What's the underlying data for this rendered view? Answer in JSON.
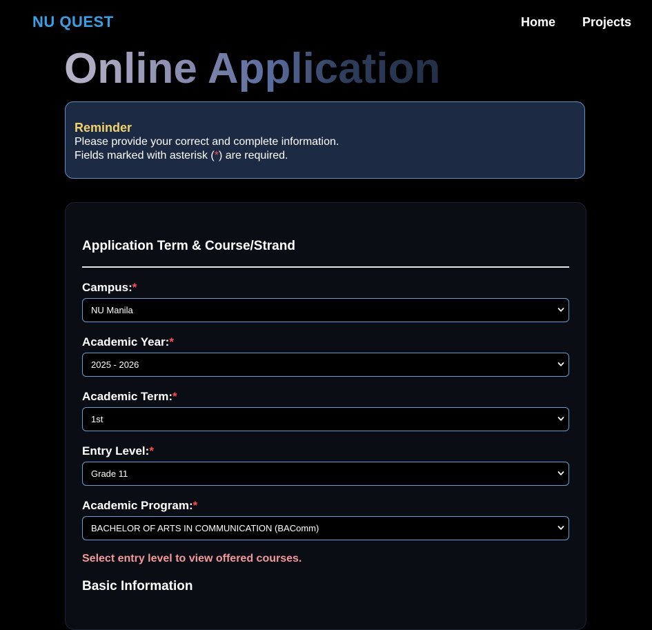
{
  "nav": {
    "brand": "NU QUEST",
    "links": [
      {
        "label": "Home"
      },
      {
        "label": "Projects"
      }
    ]
  },
  "page": {
    "title": "Online Application"
  },
  "reminder": {
    "title": "Reminder",
    "line1": "Please provide your correct and complete information.",
    "line2_before": "Fields marked with asterisk (",
    "line2_asterisk": "*",
    "line2_after": ") are required."
  },
  "form": {
    "section1_title": "Application Term & Course/Strand",
    "fields": [
      {
        "label": "Campus:",
        "required_mark": "*",
        "value": "NU Manila"
      },
      {
        "label": "Academic Year:",
        "required_mark": "*",
        "value": "2025 - 2026"
      },
      {
        "label": "Academic Term:",
        "required_mark": "*",
        "value": "1st"
      },
      {
        "label": "Entry Level:",
        "required_mark": "*",
        "value": "Grade 11"
      },
      {
        "label": "Academic Program:",
        "required_mark": "*",
        "value": "BACHELOR OF ARTS IN COMMUNICATION (BAComm)"
      }
    ],
    "hint": "Select entry level to view offered courses.",
    "section2_title": "Basic Information"
  },
  "colors": {
    "brand": "#3aa0e4",
    "reminder_title": "#f2d36b",
    "required": "#ff4d4d",
    "hint": "#f29a9a",
    "select_border": "#6a9fd6"
  }
}
